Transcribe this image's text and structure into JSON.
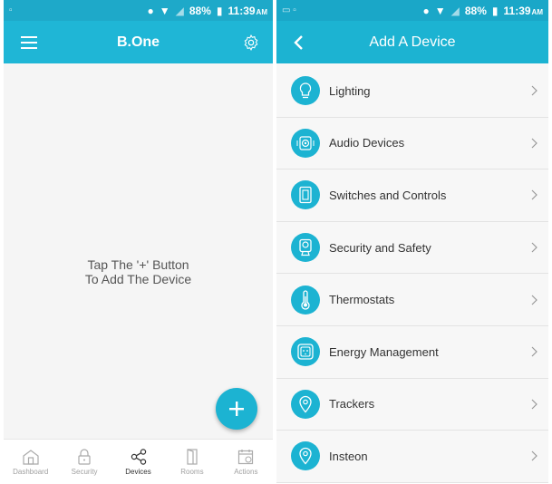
{
  "left": {
    "status": {
      "battery": "88%",
      "time": "11:39",
      "ampm": "AM"
    },
    "appbar": {
      "title": "B.One"
    },
    "empty_message": {
      "line1": "Tap The '+' Button",
      "line2": "To Add The Device"
    },
    "fab": {
      "label": "+"
    },
    "tabs": [
      {
        "label": "Dashboard",
        "icon": "home-icon"
      },
      {
        "label": "Security",
        "icon": "lock-icon"
      },
      {
        "label": "Devices",
        "icon": "share-nodes-icon"
      },
      {
        "label": "Rooms",
        "icon": "door-icon"
      },
      {
        "label": "Actions",
        "icon": "calendar-icon"
      }
    ],
    "active_tab": "Devices"
  },
  "right": {
    "status": {
      "battery": "88%",
      "time": "11:39",
      "ampm": "AM"
    },
    "appbar": {
      "title": "Add A Device"
    },
    "items": [
      {
        "label": "Lighting",
        "icon": "bulb-icon"
      },
      {
        "label": "Audio Devices",
        "icon": "speaker-icon"
      },
      {
        "label": "Switches and Controls",
        "icon": "switch-icon"
      },
      {
        "label": "Security and Safety",
        "icon": "camera-icon"
      },
      {
        "label": "Thermostats",
        "icon": "thermometer-icon"
      },
      {
        "label": "Energy Management",
        "icon": "outlet-icon"
      },
      {
        "label": "Trackers",
        "icon": "location-pin-icon"
      },
      {
        "label": "Insteon",
        "icon": "location-pin-icon"
      }
    ]
  },
  "colors": {
    "accent": "#1cb3d2",
    "statusbar": "#1aa7c8"
  }
}
